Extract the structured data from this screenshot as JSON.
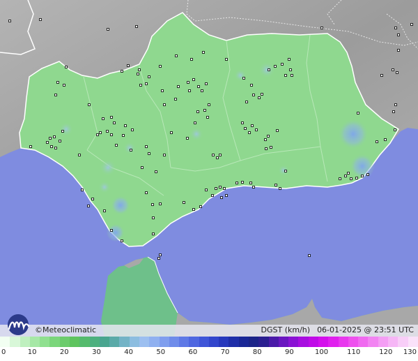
{
  "brand": {
    "copyright_symbol": "©",
    "name": "Meteoclimatic"
  },
  "caption": {
    "variable": "DGST (km/h)",
    "datetime": "06-01-2025 @ 23:51 UTC"
  },
  "legend": {
    "ticks": [
      "0",
      "10",
      "20",
      "30",
      "40",
      "50",
      "60",
      "70",
      "80",
      "90",
      "100",
      "110",
      "120",
      "130"
    ],
    "colors": [
      "#f2fff2",
      "#d8f7d8",
      "#bff0bf",
      "#a6e8a6",
      "#8fe08f",
      "#7bd67b",
      "#6ccc6c",
      "#5ec45e",
      "#55bb6d",
      "#4db07f",
      "#49a58f",
      "#5aaaa8",
      "#73b3c6",
      "#8cbde0",
      "#9cbff0",
      "#8fb0f0",
      "#7f9eee",
      "#6f8cea",
      "#5f79e6",
      "#4f67e0",
      "#3f55d8",
      "#3245cc",
      "#2738bc",
      "#1f2ea8",
      "#1a2796",
      "#1b2488",
      "#2a1f90",
      "#4a1aa8",
      "#6a16c0",
      "#8a12d4",
      "#a80ee0",
      "#c00ae8",
      "#d410ec",
      "#e020ee",
      "#e838ee",
      "#ee50ee",
      "#f06af0",
      "#f284f2",
      "#f49ef4",
      "#f6b6f6",
      "#f8cef8",
      "#fae2fa"
    ]
  },
  "map": {
    "colors": {
      "sea": "#7f8ce0",
      "land": "#a8a8a8",
      "region": "#8fd88f",
      "africa": "#6ec08a"
    },
    "gust_hotspots": [
      {
        "name": "sierra-nevada-east",
        "level": 45
      },
      {
        "name": "almeria-coast",
        "level": 42
      },
      {
        "name": "cadiz-interior",
        "level": 38
      },
      {
        "name": "cadiz-bay",
        "level": 37
      },
      {
        "name": "jaen-north",
        "level": 36
      },
      {
        "name": "cordoba-center",
        "level": 35
      },
      {
        "name": "sevilla-south",
        "level": 34
      }
    ]
  }
}
